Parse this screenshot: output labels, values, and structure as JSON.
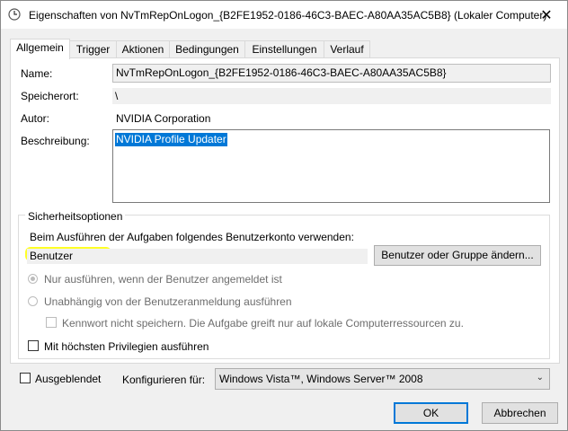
{
  "window": {
    "title": "Eigenschaften von NvTmRepOnLogon_{B2FE1952-0186-46C3-BAEC-A80AA35AC5B8} (Lokaler Computer)",
    "close_glyph": "✕"
  },
  "tabs": [
    {
      "label": "Allgemein",
      "active": true
    },
    {
      "label": "Trigger"
    },
    {
      "label": "Aktionen"
    },
    {
      "label": "Bedingungen"
    },
    {
      "label": "Einstellungen"
    },
    {
      "label": "Verlauf"
    }
  ],
  "general": {
    "name_label": "Name:",
    "name_value": "NvTmRepOnLogon_{B2FE1952-0186-46C3-BAEC-A80AA35AC5B8}",
    "location_label": "Speicherort:",
    "location_value": "\\",
    "author_label": "Autor:",
    "author_value": "NVIDIA Corporation",
    "description_label": "Beschreibung:",
    "description_value": "NVIDIA Profile Updater"
  },
  "security": {
    "group_title": "Sicherheitsoptionen",
    "account_prompt": "Beim Ausführen der Aufgaben folgendes Benutzerkonto verwenden:",
    "account_value": "Benutzer",
    "change_user_button": "Benutzer oder Gruppe ändern...",
    "option_logged_on": "Nur ausführen, wenn der Benutzer angemeldet ist",
    "option_independent": "Unabhängig von der Benutzeranmeldung ausführen",
    "option_no_password": "Kennwort nicht speichern. Die Aufgabe greift nur auf lokale Computerressourcen zu.",
    "option_highest": "Mit höchsten Privilegien ausführen"
  },
  "footer": {
    "hidden_label": "Ausgeblendet",
    "configure_label": "Konfigurieren für:",
    "configure_value": "Windows Vista™, Windows Server™ 2008",
    "ok_button": "OK",
    "cancel_button": "Abbrechen"
  },
  "colors": {
    "accent": "#0078d7",
    "highlight": "#ffff00"
  }
}
